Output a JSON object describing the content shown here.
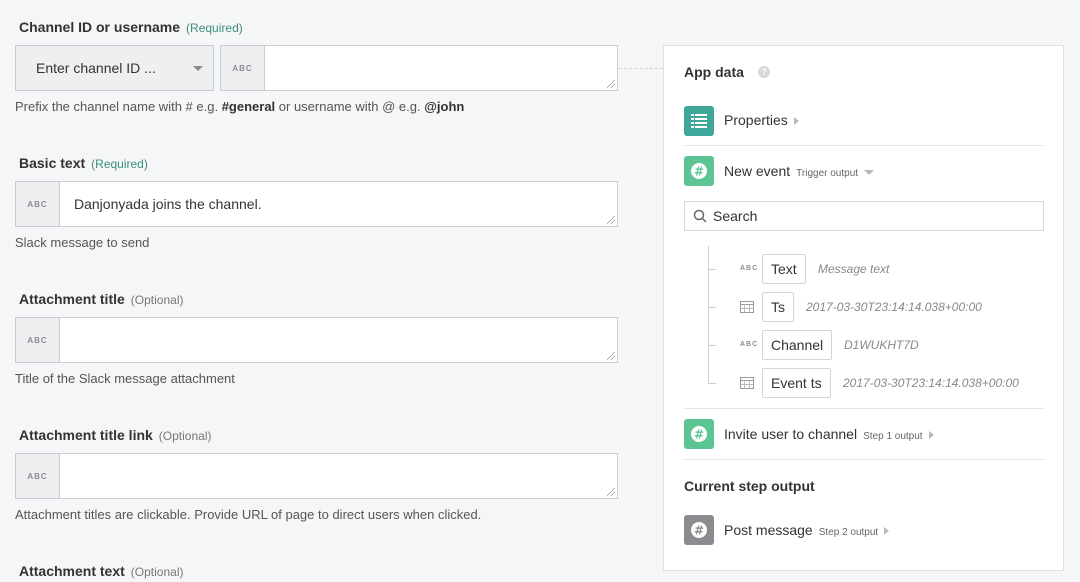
{
  "form": {
    "channel": {
      "label": "Channel ID or username",
      "tag": "(Required)",
      "dropdown_value": "Enter channel ID ...",
      "type_badge": "ABC",
      "value": "",
      "hint_prefix": "Prefix the channel name with # e.g. ",
      "hint_ex1": "#general",
      "hint_mid": " or username with @ e.g. ",
      "hint_ex2": "@john"
    },
    "basic_text": {
      "label": "Basic text",
      "tag": "(Required)",
      "type_badge": "ABC",
      "value": "Danjonyada joins the channel.",
      "hint": "Slack message to send"
    },
    "attachment_title": {
      "label": "Attachment title",
      "tag": "(Optional)",
      "type_badge": "ABC",
      "value": "",
      "hint": "Title of the Slack message attachment"
    },
    "attachment_title_link": {
      "label": "Attachment title link",
      "tag": "(Optional)",
      "type_badge": "ABC",
      "value": "",
      "hint": "Attachment titles are clickable. Provide URL of page to direct users when clicked."
    },
    "attachment_text": {
      "label": "Attachment text",
      "tag": "(Optional)"
    }
  },
  "panel": {
    "title": "App data",
    "help": "?",
    "properties": "Properties",
    "new_event": {
      "label": "New event",
      "sub": "Trigger output"
    },
    "search_placeholder": "Search",
    "fields": [
      {
        "type": "ABC",
        "name": "Text",
        "value": "Message text"
      },
      {
        "type": "calendar",
        "name": "Ts",
        "value": "2017-03-30T23:14:14.038+00:00"
      },
      {
        "type": "ABC",
        "name": "Channel",
        "value": "D1WUKHT7D"
      },
      {
        "type": "calendar",
        "name": "Event ts",
        "value": "2017-03-30T23:14:14.038+00:00"
      }
    ],
    "invite": {
      "label": "Invite user to channel",
      "sub": "Step 1 output"
    },
    "current_step_title": "Current step output",
    "post_message": {
      "label": "Post message",
      "sub": "Step 2 output"
    }
  },
  "colors": {
    "required": "#3d8f7c",
    "teal_icon": "#3fa79a",
    "green_icon": "#5cc593",
    "gray_icon": "#8a8c8f"
  }
}
